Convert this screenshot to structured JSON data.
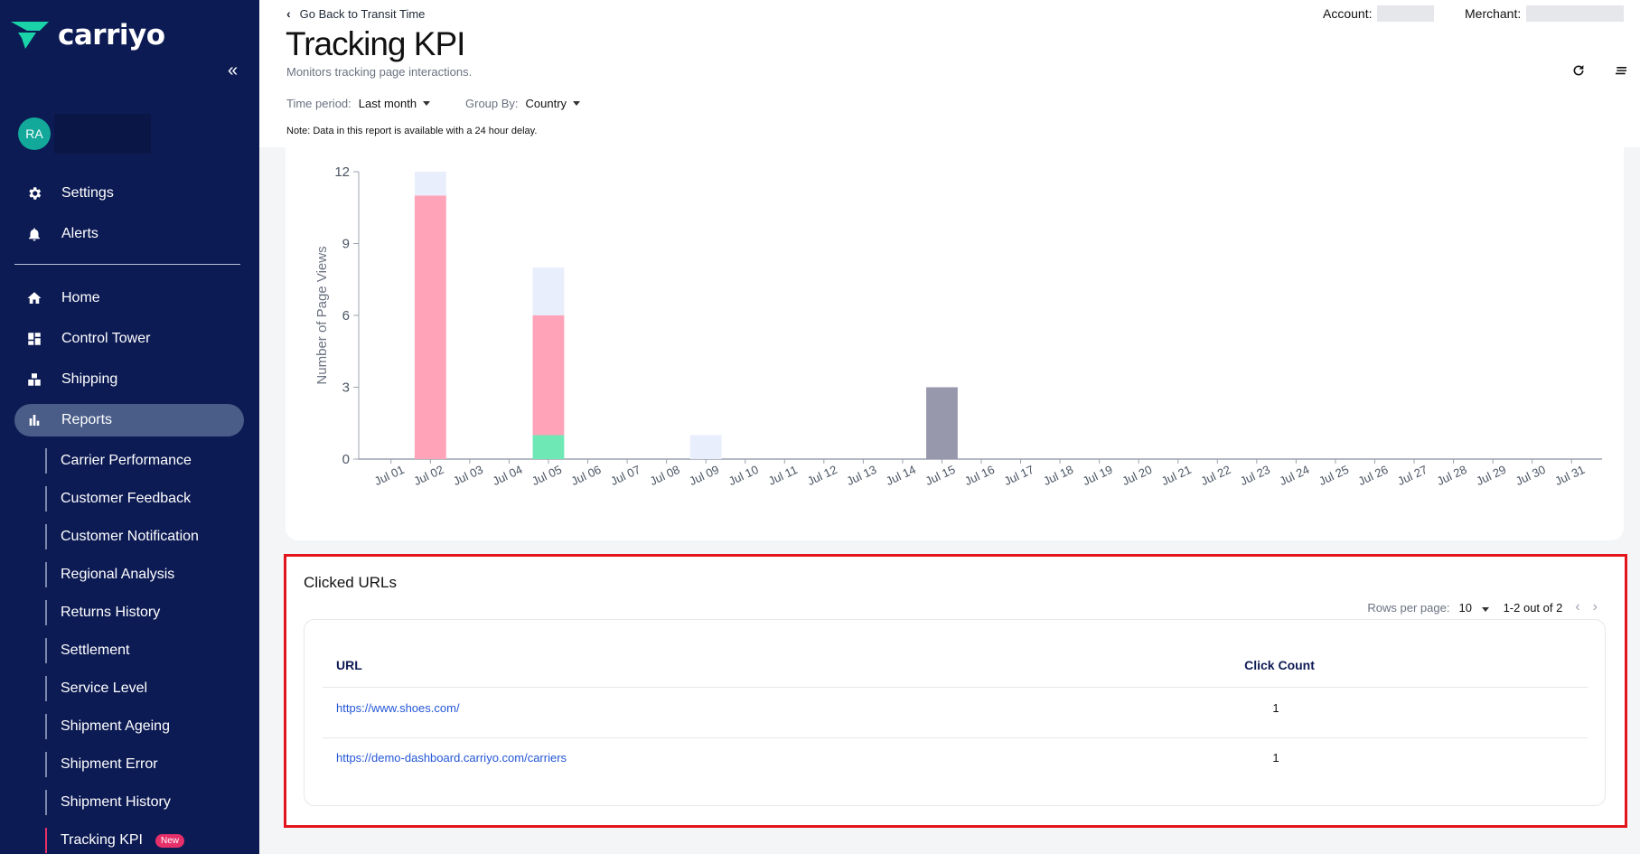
{
  "brand": {
    "name": "carriyo",
    "accent": "#1ad3a8",
    "sidebar_bg": "#0d1b54"
  },
  "user": {
    "initials": "RA"
  },
  "sidebar": {
    "top_items": [
      {
        "label": "Settings",
        "icon": "gear-icon"
      },
      {
        "label": "Alerts",
        "icon": "bell-icon"
      }
    ],
    "main_items": [
      {
        "label": "Home",
        "icon": "home-icon"
      },
      {
        "label": "Control Tower",
        "icon": "dashboard-icon"
      },
      {
        "label": "Shipping",
        "icon": "shipping-icon"
      },
      {
        "label": "Reports",
        "icon": "bar-chart-icon",
        "active": true
      }
    ],
    "report_items": [
      "Carrier Performance",
      "Customer Feedback",
      "Customer Notification",
      "Regional Analysis",
      "Returns History",
      "Settlement",
      "Service Level",
      "Shipment Ageing",
      "Shipment Error",
      "Shipment History",
      "Tracking KPI"
    ],
    "new_badge": "New"
  },
  "header": {
    "back_label": "Go Back to Transit Time",
    "title": "Tracking KPI",
    "subtitle": "Monitors tracking page interactions.",
    "account_label": "Account:",
    "merchant_label": "Merchant:",
    "time_period_label": "Time period:",
    "time_period_value": "Last month",
    "group_by_label": "Group By:",
    "group_by_value": "Country",
    "note": "Note: Data in this report is available with a 24 hour delay."
  },
  "chart_data": {
    "type": "bar",
    "stacked": true,
    "ylabel": "Number of Page Views",
    "ylim": [
      0,
      12
    ],
    "yticks": [
      0,
      3,
      6,
      9,
      12
    ],
    "categories": [
      "Jul 01",
      "Jul 02",
      "Jul 03",
      "Jul 04",
      "Jul 05",
      "Jul 06",
      "Jul 07",
      "Jul 08",
      "Jul 09",
      "Jul 10",
      "Jul 11",
      "Jul 12",
      "Jul 13",
      "Jul 14",
      "Jul 15",
      "Jul 16",
      "Jul 17",
      "Jul 18",
      "Jul 19",
      "Jul 20",
      "Jul 21",
      "Jul 22",
      "Jul 23",
      "Jul 24",
      "Jul 25",
      "Jul 26",
      "Jul 27",
      "Jul 28",
      "Jul 29",
      "Jul 30",
      "Jul 31"
    ],
    "series": [
      {
        "color": "#6ee9b6",
        "values": [
          0,
          0,
          0,
          0,
          1,
          0,
          0,
          0,
          0,
          0,
          0,
          0,
          0,
          0,
          0,
          0,
          0,
          0,
          0,
          0,
          0,
          0,
          0,
          0,
          0,
          0,
          0,
          0,
          0,
          0,
          0
        ]
      },
      {
        "color": "#ffa3b8",
        "values": [
          0,
          11,
          0,
          0,
          5,
          0,
          0,
          0,
          0,
          0,
          0,
          0,
          0,
          0,
          0,
          0,
          0,
          0,
          0,
          0,
          0,
          0,
          0,
          0,
          0,
          0,
          0,
          0,
          0,
          0,
          0
        ]
      },
      {
        "color": "#e9eefc",
        "values": [
          0,
          1,
          0,
          0,
          2,
          0,
          0,
          0,
          1,
          0,
          0,
          0,
          0,
          0,
          0,
          0,
          0,
          0,
          0,
          0,
          0,
          0,
          0,
          0,
          0,
          0,
          0,
          0,
          0,
          0,
          0
        ]
      },
      {
        "color": "#9898ac",
        "values": [
          0,
          0,
          0,
          0,
          0,
          0,
          0,
          0,
          0,
          0,
          0,
          0,
          0,
          0,
          3,
          0,
          0,
          0,
          0,
          0,
          0,
          0,
          0,
          0,
          0,
          0,
          0,
          0,
          0,
          0,
          0
        ]
      }
    ]
  },
  "clicked_urls": {
    "title": "Clicked URLs",
    "rows_per_page_label": "Rows per page:",
    "rows_per_page_value": "10",
    "range_label": "1-2 out of 2",
    "columns": [
      "URL",
      "Click Count"
    ],
    "rows": [
      {
        "url": "https://www.shoes.com/",
        "count": "1"
      },
      {
        "url": "https://demo-dashboard.carriyo.com/carriers",
        "count": "1"
      }
    ]
  }
}
